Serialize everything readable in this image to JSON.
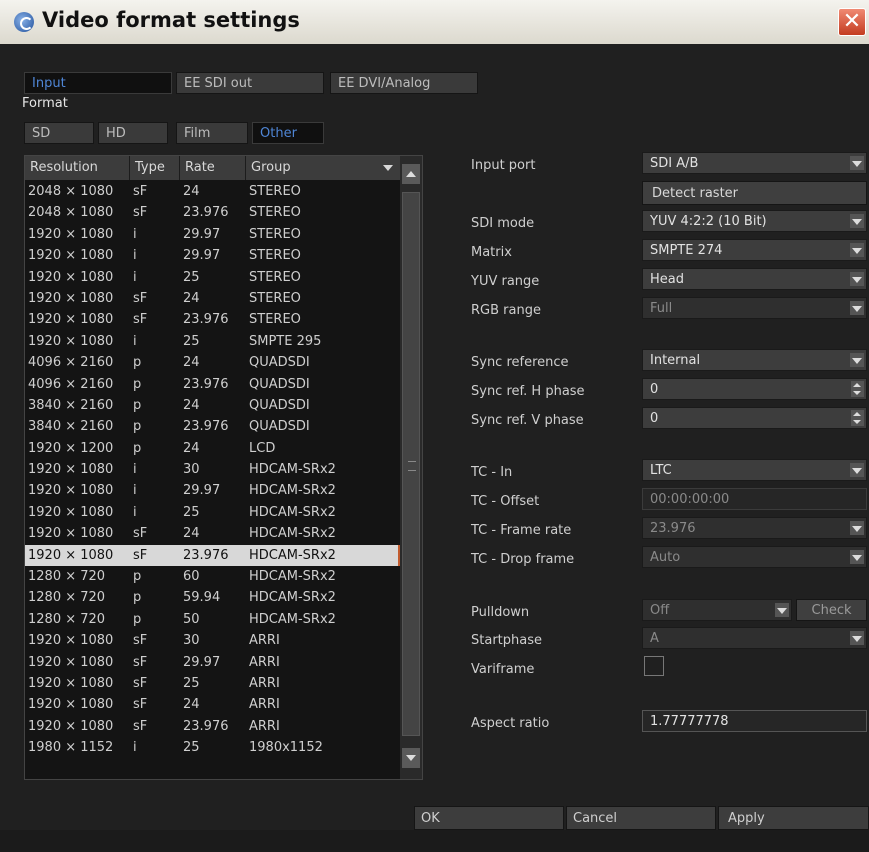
{
  "window": {
    "title": "Video format settings"
  },
  "tabs": [
    "Input",
    "EE SDI out",
    "EE DVI/Analog"
  ],
  "section_label": "Format",
  "filter_tabs": [
    "SD",
    "HD",
    "Film",
    "Other"
  ],
  "columns": [
    "Resolution",
    "Type",
    "Rate",
    "Group"
  ],
  "formats": [
    [
      "2048 × 1080",
      "sF",
      "24",
      "STEREO"
    ],
    [
      "2048 × 1080",
      "sF",
      "23.976",
      "STEREO"
    ],
    [
      "1920 × 1080",
      "i",
      "29.97",
      "STEREO"
    ],
    [
      "1920 × 1080",
      "i",
      "29.97",
      "STEREO"
    ],
    [
      "1920 × 1080",
      "i",
      "25",
      "STEREO"
    ],
    [
      "1920 × 1080",
      "sF",
      "24",
      "STEREO"
    ],
    [
      "1920 × 1080",
      "sF",
      "23.976",
      "STEREO"
    ],
    [
      "1920 × 1080",
      "i",
      "25",
      "SMPTE 295"
    ],
    [
      "4096 × 2160",
      "p",
      "24",
      "QUADSDI"
    ],
    [
      "4096 × 2160",
      "p",
      "23.976",
      "QUADSDI"
    ],
    [
      "3840 × 2160",
      "p",
      "24",
      "QUADSDI"
    ],
    [
      "3840 × 2160",
      "p",
      "23.976",
      "QUADSDI"
    ],
    [
      "1920 × 1200",
      "p",
      "24",
      "LCD"
    ],
    [
      "1920 × 1080",
      "i",
      "30",
      "HDCAM-SRx2"
    ],
    [
      "1920 × 1080",
      "i",
      "29.97",
      "HDCAM-SRx2"
    ],
    [
      "1920 × 1080",
      "i",
      "25",
      "HDCAM-SRx2"
    ],
    [
      "1920 × 1080",
      "sF",
      "24",
      "HDCAM-SRx2"
    ],
    [
      "1920 × 1080",
      "sF",
      "23.976",
      "HDCAM-SRx2"
    ],
    [
      "1280 × 720",
      "p",
      "60",
      "HDCAM-SRx2"
    ],
    [
      "1280 × 720",
      "p",
      "59.94",
      "HDCAM-SRx2"
    ],
    [
      "1280 × 720",
      "p",
      "50",
      "HDCAM-SRx2"
    ],
    [
      "1920 × 1080",
      "sF",
      "30",
      "ARRI"
    ],
    [
      "1920 × 1080",
      "sF",
      "29.97",
      "ARRI"
    ],
    [
      "1920 × 1080",
      "sF",
      "25",
      "ARRI"
    ],
    [
      "1920 × 1080",
      "sF",
      "24",
      "ARRI"
    ],
    [
      "1920 × 1080",
      "sF",
      "23.976",
      "ARRI"
    ],
    [
      "1980 × 1152",
      "i",
      "25",
      "1980x1152"
    ]
  ],
  "settings": {
    "input_port_label": "Input port",
    "input_port": "SDI A/B",
    "detect_raster": "Detect raster",
    "sdi_mode_label": "SDI mode",
    "sdi_mode": "YUV 4:2:2 (10 Bit)",
    "matrix_label": "Matrix",
    "matrix": "SMPTE 274",
    "yuv_range_label": "YUV range",
    "yuv_range": "Head",
    "rgb_range_label": "RGB range",
    "rgb_range": "Full",
    "sync_ref_label": "Sync reference",
    "sync_ref": "Internal",
    "sync_h_label": "Sync ref. H phase",
    "sync_h": "0",
    "sync_v_label": "Sync ref. V phase",
    "sync_v": "0",
    "tc_in_label": "TC - In",
    "tc_in": "LTC",
    "tc_offset_label": "TC - Offset",
    "tc_offset": "00:00:00:00",
    "tc_rate_label": "TC - Frame rate",
    "tc_rate": "23.976",
    "tc_drop_label": "TC - Drop frame",
    "tc_drop": "Auto",
    "pulldown_label": "Pulldown",
    "pulldown": "Off",
    "check_button": "Check",
    "startphase_label": "Startphase",
    "startphase": "A",
    "variframe_label": "Variframe",
    "aspect_label": "Aspect ratio",
    "aspect": "1.77777778"
  },
  "footer": {
    "ok": "OK",
    "cancel": "Cancel",
    "apply": "Apply"
  }
}
